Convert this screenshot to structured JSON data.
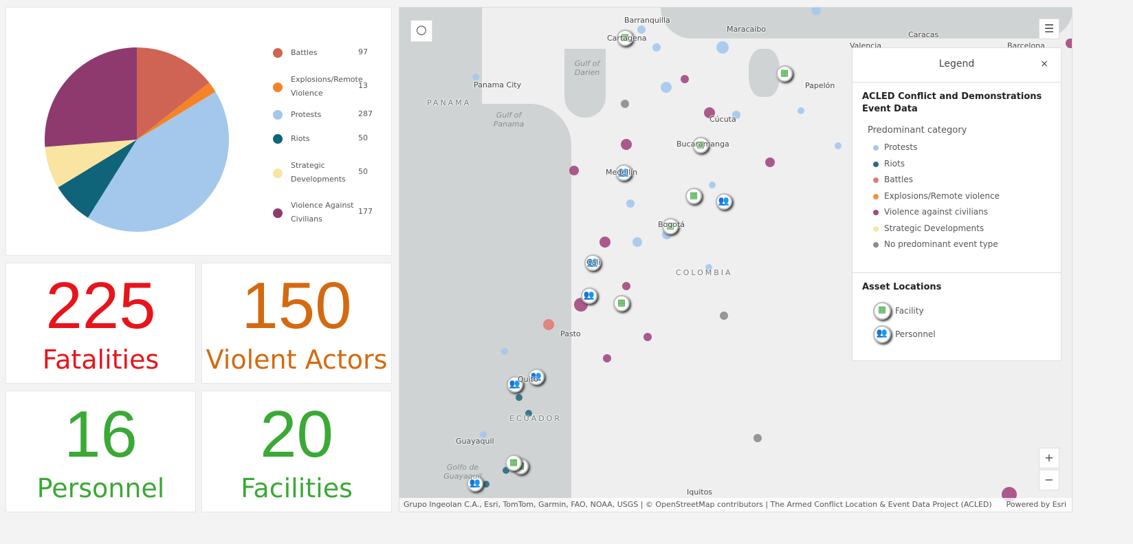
{
  "pie": {
    "chart_data": {
      "type": "pie",
      "categories": [
        "Battles",
        "Explosions/Remote Violence",
        "Protests",
        "Riots",
        "Strategic Developments",
        "Violence Against Civilians"
      ],
      "values": [
        97,
        13,
        287,
        50,
        50,
        177
      ],
      "colors": [
        "#d06454",
        "#f58426",
        "#a3c8ec",
        "#0f6479",
        "#f9e4a1",
        "#8e3a6e"
      ]
    },
    "legend": [
      {
        "label": "Battles",
        "value": "97"
      },
      {
        "label": "Explosions/Remote Violence",
        "value": "13"
      },
      {
        "label": "Protests",
        "value": "287"
      },
      {
        "label": "Riots",
        "value": "50"
      },
      {
        "label": "Strategic Developments",
        "value": "50"
      },
      {
        "label": "Violence Against Civilians",
        "value": "177"
      }
    ]
  },
  "kpis": [
    {
      "value": "225",
      "label": "Fatalities",
      "color": "#e8141b"
    },
    {
      "value": "150",
      "label": "Violent Actors",
      "color": "#d46a10"
    },
    {
      "value": "16",
      "label": "Personnel",
      "color": "#3aa935"
    },
    {
      "value": "20",
      "label": "Facilities",
      "color": "#3aa935"
    }
  ],
  "map": {
    "labels": {
      "barranquilla": "Barranquilla",
      "cartagena": "Cartagena",
      "maracaibo": "Maracaibo",
      "caracas": "Caracas",
      "valencia": "Valencia",
      "barcelona": "Barcelona",
      "panama_city": "Panama City",
      "panama": "PANAMA",
      "gulf_darien": "Gulf of Darien",
      "gulf_panama": "Gulf of Panama",
      "papelon": "Papelón",
      "cucuta": "Cúcuta",
      "bucaramanga": "Bucaramanga",
      "medellin": "Medellín",
      "bogota": "Bogotá",
      "colombia": "COLOMBIA",
      "cali": "Cali",
      "pasto": "Pasto",
      "quito": "Quito",
      "ecuador": "ECUADOR",
      "guayaquil": "Guayaquil",
      "golfo_guayaquil": "Golfo de Guayaquil",
      "iquitos": "Iquitos"
    },
    "attribution": "Grupo Ingeolan C.A., Esri, TomTom, Garmin, FAO, NOAA, USGS | © OpenStreetMap contributors | The Armed Conflict Location & Event Data Project (ACLED)",
    "powered_by": "Powered by Esri",
    "zoom_in": "+",
    "zoom_out": "−",
    "legend": {
      "title": "Legend",
      "close": "×",
      "layer_title": "ACLED Conflict and Demonstrations Event Data",
      "subtitle": "Predominant category",
      "items": [
        {
          "label": "Protests",
          "color": "#a3c8ec"
        },
        {
          "label": "Riots",
          "color": "#2b6b7f"
        },
        {
          "label": "Battles",
          "color": "#e07b74"
        },
        {
          "label": "Explosions/Remote violence",
          "color": "#f0903e"
        },
        {
          "label": "Violence against civilians",
          "color": "#a3487e"
        },
        {
          "label": "Strategic Developments",
          "color": "#f9e8a0"
        },
        {
          "label": "No predominant event type",
          "color": "#8c8c8c"
        }
      ],
      "asset_title": "Asset Locations",
      "assets": [
        {
          "label": "Facility",
          "icon": "building-icon"
        },
        {
          "label": "Personnel",
          "icon": "people-icon"
        }
      ]
    }
  }
}
